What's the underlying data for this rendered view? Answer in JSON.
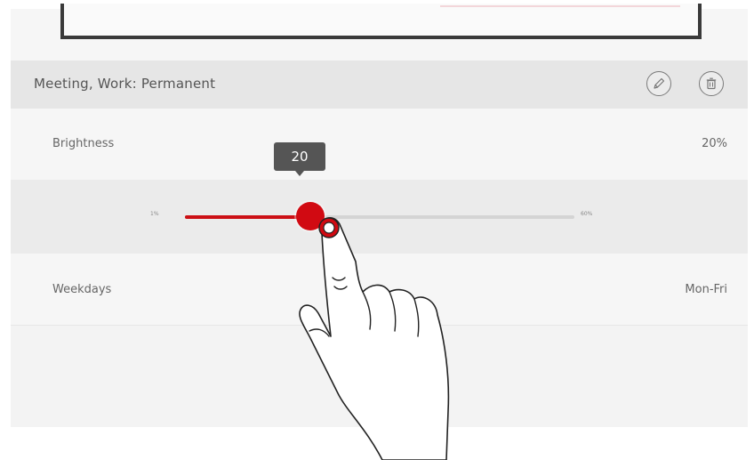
{
  "header": {
    "title": "Meeting, Work: Permanent",
    "edit_icon": "pencil-icon",
    "delete_icon": "trash-icon"
  },
  "brightness": {
    "label": "Brightness",
    "value_text": "20%"
  },
  "slider": {
    "min_label": "1%",
    "max_label": "60%",
    "min": 1,
    "max": 60,
    "value": 20,
    "tooltip": "20",
    "accent_color": "#cc1015"
  },
  "weekdays": {
    "label": "Weekdays",
    "value_text": "Mon-Fri"
  },
  "overlay": {
    "icon": "pointing-hand-icon"
  }
}
